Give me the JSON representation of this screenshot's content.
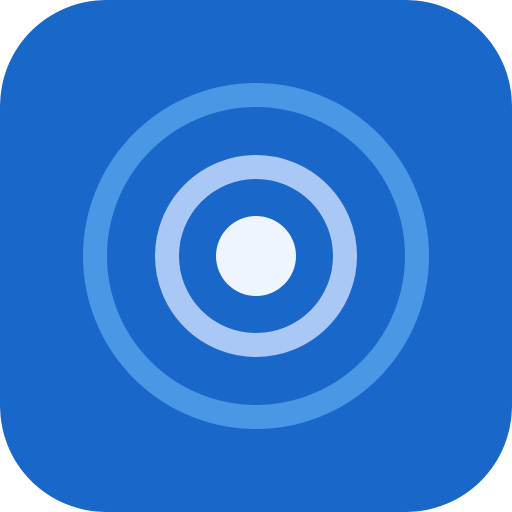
{
  "icon": {
    "name": "radar-broadcast-icon",
    "colors": {
      "background": "#1967C9",
      "outer_ring": "#4A97E6",
      "inner_ring": "#A9C8F5",
      "center_dot": "#EEF5FE"
    }
  }
}
